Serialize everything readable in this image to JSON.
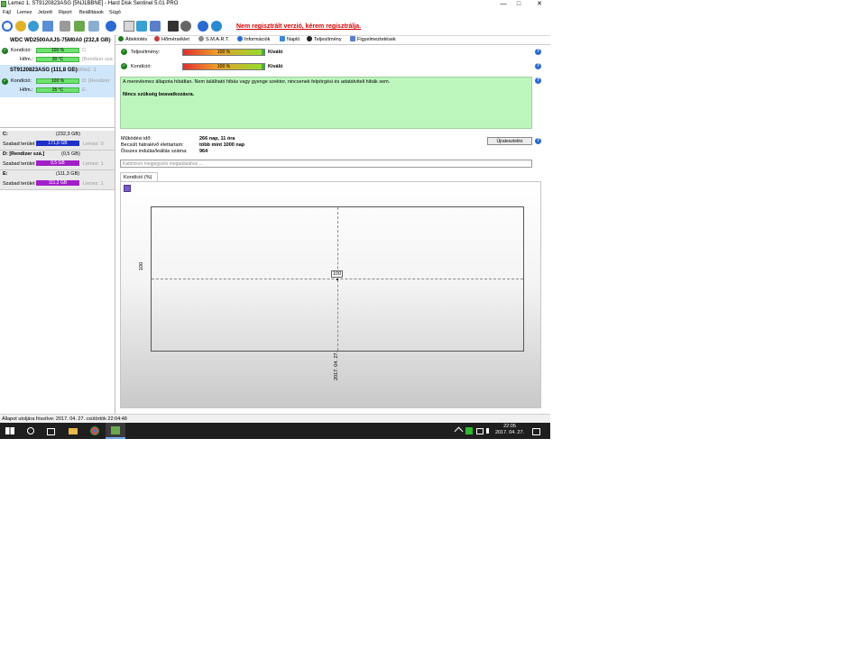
{
  "window": {
    "title": "Lemez 1, ST9120823ASG [5NJ1BBNE]  -  Hard Disk Sentinel 5.01 PRO",
    "min_label": "—",
    "max_label": "□",
    "close_label": "✕"
  },
  "menu": [
    "Fájl",
    "Lemez",
    "Jelzett",
    "Riport",
    "Beállítások",
    "Súgó"
  ],
  "nag_text": "Nem regisztrált verzió, kérem regisztrálja.",
  "disks": [
    {
      "name": "WDC WD2500AAJS-75M0A0 (232,8 GB)",
      "suffix": "Le",
      "health_label": "Kondíció:",
      "health_value": "100 %",
      "health_vol": "C:",
      "temp_label": "Hőm.:",
      "temp_value": "30 °C",
      "temp_vol": "[Rendizer sza"
    },
    {
      "name": "ST9120823ASG (111,8 GB)",
      "suffix": "Lemez: 1",
      "health_label": "Kondíció:",
      "health_value": "100 %",
      "health_vol": "D: [Rendizer",
      "temp_label": "Hőm.:",
      "temp_value": "25 °C",
      "temp_vol": "E:"
    }
  ],
  "volumes": [
    {
      "letter": "C:",
      "size": "(232,3 GB)",
      "free_label": "Szabad terület",
      "free_value": "171,6 GB",
      "disk": "Lemez: 0",
      "color": "#1f2fc8"
    },
    {
      "letter": "D: [Rendizer szá.]",
      "size": "(0,5 GB)",
      "free_label": "Szabad terület",
      "free_value": "0,5 GB",
      "disk": "Lemez: 1",
      "color": "#a21fc8"
    },
    {
      "letter": "E:",
      "size": "(111,3 GB)",
      "free_label": "Szabad terület",
      "free_value": "111,2 GB",
      "disk": "Lemez: 1",
      "color": "#a21fc8"
    }
  ],
  "tabs": [
    "Áttekintés",
    "Hőmérséklet",
    "S.M.A.R.T.",
    "Információk",
    "Napló",
    "Teljesítmény",
    "Figyelmeztetések"
  ],
  "overview": {
    "performance_label": "Teljesítmény:",
    "performance_bar": "100 %",
    "performance_value": 100,
    "performance_text": "Kiváló",
    "health_label": "Kondíció:",
    "health_bar": "100 %",
    "health_value": 100,
    "health_text": "Kiváló",
    "status_message": "A merevlemez állapota hibátlan. Nem található hibás vagy gyenge szektor, nincsenek felpörgési és adatátviteli hibák sem.",
    "status_action": "Nincs szükség beavatkozásra.",
    "uptime_label": "Működési idő:",
    "uptime_value": "266 nap, 11 óra",
    "remaining_label": "Becsült hátralévő élettartam:",
    "remaining_value": "több mint 1000 nap",
    "starts_label": "Összes indulás/leállás száma:",
    "starts_value": "964",
    "retest_button": "Újratesztelés",
    "note_placeholder": "Kattintson megjegyzés megadásához ...",
    "chart_tab": "Kondíció  (%)"
  },
  "chart_data": {
    "type": "line",
    "x": [
      "2017. 04. 27."
    ],
    "series": [
      {
        "values": [
          100
        ]
      }
    ],
    "ytick": "100",
    "point_label": "100",
    "grid": true
  },
  "status_line": "Állapot utoljára frissítve: 2017. 04. 27. csütörtök 22:04:48",
  "taskbar": {
    "time": "22:05",
    "date": "2017. 04. 27."
  },
  "colors": {
    "accent": "#6fe26f",
    "status_green": "#bdf6bd",
    "nag": "#d40000"
  }
}
